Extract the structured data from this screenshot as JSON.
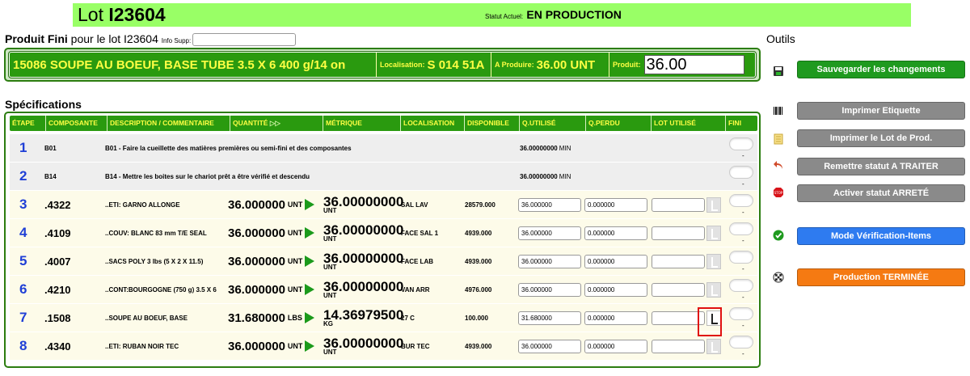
{
  "header": {
    "lot_label": "Lot",
    "lot_number": "I23604",
    "status_label": "Statut Actuel:",
    "status_value": "EN PRODUCTION"
  },
  "produit_fini": {
    "label_bold": "Produit Fini",
    "label_rest": "pour le lot I23604",
    "info_label": "Info Supp:",
    "info_value": "",
    "name": "15086 SOUPE AU BOEUF, BASE TUBE 3.5 X 6 400 g/14 on",
    "localisation_label": "Localisation:",
    "localisation_value": "S 014 51A",
    "a_produire_label": "A Produire:",
    "a_produire_value": "36.00 UNT",
    "produit_label": "Produit:",
    "produit_value": "36.00"
  },
  "outils": {
    "title": "Outils",
    "buttons": [
      {
        "label": "Sauvegarder les changements",
        "icon": "floppy-icon",
        "color": "#1f9a1f"
      },
      {
        "label": "Imprimer Etiquette",
        "icon": "barcode-icon",
        "color": "#8a8a8a"
      },
      {
        "label": "Imprimer le Lot de Prod.",
        "icon": "document-icon",
        "color": "#8a8a8a"
      },
      {
        "label": "Remettre statut A TRAITER",
        "icon": "undo-arrow-icon",
        "color": "#8a8a8a"
      },
      {
        "label": "Activer statut ARRETÉ",
        "icon": "stop-sign-icon",
        "color": "#8a8a8a"
      },
      {
        "label": "Mode Vérification-Items",
        "icon": "check-circle-icon",
        "color": "#2e7bf0"
      },
      {
        "label": "Production TERMINÉE",
        "icon": "checkered-flag-icon",
        "color": "#f57a12"
      }
    ]
  },
  "specs": {
    "title": "Spécifications",
    "columns": [
      "ÉTAPE",
      "COMPOSANTE",
      "DESCRIPTION / COMMENTAIRE",
      "QUANTITÉ",
      "MÉTRIQUE",
      "LOCALISATION",
      "DISPONIBLE",
      "Q.UTILISÉ",
      "Q.PERDU",
      "LOT UTILISÉ",
      "FINI"
    ],
    "rows": [
      {
        "step": "1",
        "comp": "B01",
        "desc": "B01 - Faire la cueillette des matières premières ou semi-fini et des composantes",
        "qinfo": "36.00000000",
        "qinfo_unit": "MIN",
        "fini": "-"
      },
      {
        "step": "2",
        "comp": "B14",
        "desc": "B14 - Mettre les boites sur le chariot prêt a être vérifié et descendu",
        "qinfo": "36.00000000",
        "qinfo_unit": "MIN",
        "fini": "-"
      },
      {
        "step": "3",
        "comp": ".4322",
        "desc": "..ETI: GARNO ALLONGE",
        "qty": "36.000000",
        "qty_unit": "UNT",
        "met": "36.00000000",
        "met_unit": "UNT",
        "loc": "SAL LAV",
        "dispo": "28579.000",
        "q_used": "36.000000",
        "q_lost": "0.000000",
        "fini": "-"
      },
      {
        "step": "4",
        "comp": ".4109",
        "desc": "..COUV: BLANC 83 mm T/E SEAL",
        "qty": "36.000000",
        "qty_unit": "UNT",
        "met": "36.00000000",
        "met_unit": "UNT",
        "loc": "FACE SAL 1",
        "dispo": "4939.000",
        "q_used": "36.000000",
        "q_lost": "0.000000",
        "fini": "-"
      },
      {
        "step": "5",
        "comp": ".4007",
        "desc": "..SACS POLY 3 lbs (5 X 2 X 11.5)",
        "qty": "36.000000",
        "qty_unit": "UNT",
        "met": "36.00000000",
        "met_unit": "UNT",
        "loc": "FACE LAB",
        "dispo": "4939.000",
        "q_used": "36.000000",
        "q_lost": "0.000000",
        "fini": "-"
      },
      {
        "step": "6",
        "comp": ".4210",
        "desc": "..CONT:BOURGOGNE (750 g) 3.5 X 6",
        "qty": "36.000000",
        "qty_unit": "UNT",
        "met": "36.00000000",
        "met_unit": "UNT",
        "loc": "VAN ARR",
        "dispo": "4976.000",
        "q_used": "36.000000",
        "q_lost": "0.000000",
        "fini": "-"
      },
      {
        "step": "7",
        "comp": ".1508",
        "desc": "..SOUPE AU BOEUF, BASE",
        "qty": "31.680000",
        "qty_unit": "LBS",
        "met": "14.36979500",
        "met_unit": "KG",
        "loc": "27 C",
        "dispo": "100.000",
        "q_used": "31.680000",
        "q_lost": "0.000000",
        "fini": "-"
      },
      {
        "step": "8",
        "comp": ".4340",
        "desc": "..ETI: RUBAN NOIR TEC",
        "qty": "36.000000",
        "qty_unit": "UNT",
        "met": "36.00000000",
        "met_unit": "UNT",
        "loc": "BUR TEC",
        "dispo": "4939.000",
        "q_used": "36.000000",
        "q_lost": "0.000000",
        "fini": "-"
      }
    ]
  }
}
